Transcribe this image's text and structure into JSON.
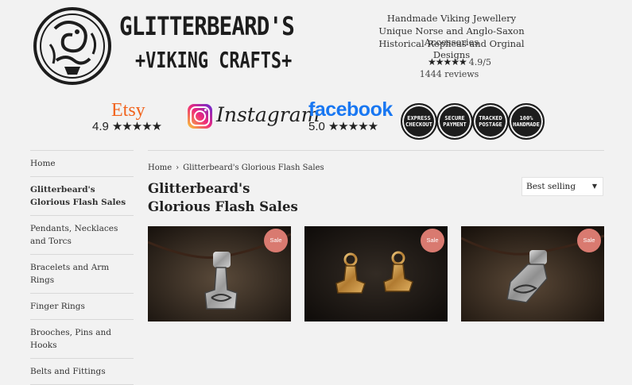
{
  "header": {
    "brand_line1": "GLITTERBEARD'S",
    "brand_line2": "+VIKING CRAFTS+",
    "taglines": [
      "Handmade Viking Jewellery",
      "Unique Norse and Anglo-Saxon Accessories",
      "Historical Replicas and Orginal Designs"
    ],
    "rating_stars": "★★★★★",
    "rating_score": "4.9/5",
    "reviews": "1444 reviews"
  },
  "badges": {
    "etsy": {
      "name": "Etsy",
      "score": "4.9",
      "stars": "★★★★★",
      "color": "#f1641e"
    },
    "instagram": {
      "name": "Instagram",
      "icon": "instagram-icon"
    },
    "facebook": {
      "name": "facebook",
      "score": "5.0",
      "stars": "★★★★★",
      "color": "#1877f2"
    },
    "seals": [
      {
        "label": "EXPRESS CHECKOUT"
      },
      {
        "label": "SECURE PAYMENT"
      },
      {
        "label": "TRACKED POSTAGE"
      },
      {
        "label": "100% HANDMADE"
      }
    ]
  },
  "sidebar": {
    "items": [
      {
        "label": "Home"
      },
      {
        "label": "Glitterbeard's Glorious Flash Sales",
        "active": true
      },
      {
        "label": "Pendants, Necklaces and Torcs"
      },
      {
        "label": "Bracelets and Arm Rings"
      },
      {
        "label": "Finger Rings"
      },
      {
        "label": "Brooches, Pins and Hooks"
      },
      {
        "label": "Belts and Fittings"
      }
    ]
  },
  "main": {
    "breadcrumb": {
      "home": "Home",
      "separator": "›",
      "current": "Glitterbeard's Glorious Flash Sales"
    },
    "title_line1": "Glitterbeard's",
    "title_line2": "Glorious Flash Sales",
    "sort": {
      "selected": "Best selling"
    },
    "products": [
      {
        "badge": "Sale",
        "image": "silver-thors-hammer-pendant"
      },
      {
        "badge": "Sale",
        "image": "bronze-thors-hammer-earrings"
      },
      {
        "badge": "Sale",
        "image": "silver-thors-hammer-pendant"
      }
    ],
    "sale_color": "#d97a70"
  }
}
